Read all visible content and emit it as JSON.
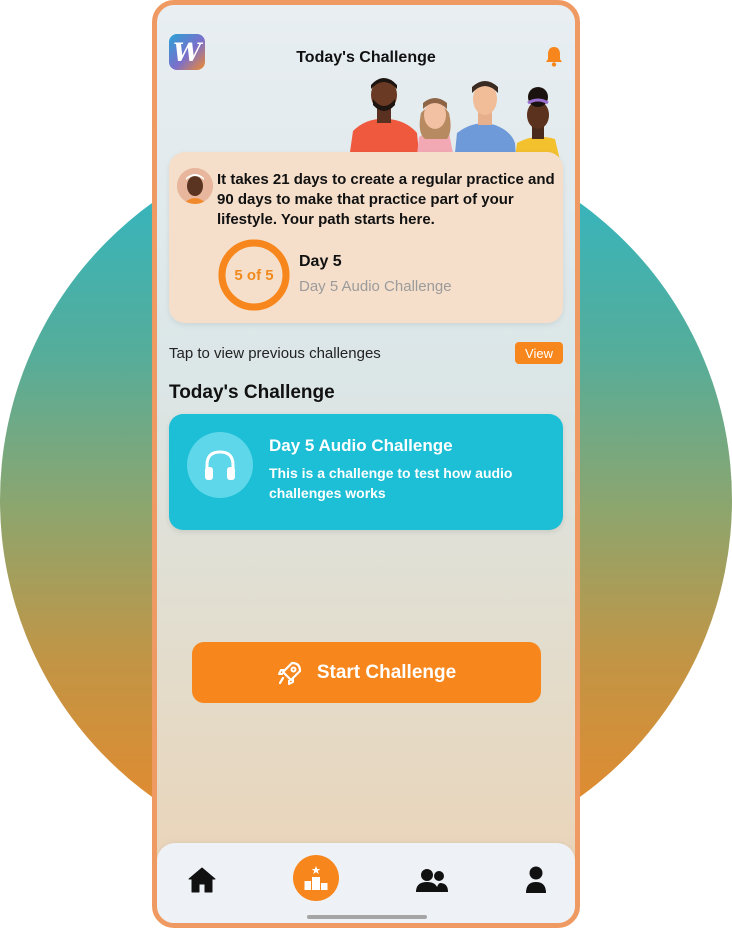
{
  "header": {
    "title": "Today's Challenge",
    "logo_letter": "W"
  },
  "info_card": {
    "message": "It takes 21 days to create a regular practice and 90 days to make that practice part of your lifestyle. Your path starts here.",
    "progress_label": "5 of 5",
    "progress_fraction": 1.0,
    "day_title": "Day 5",
    "day_subtitle": "Day 5 Audio Challenge"
  },
  "previous": {
    "text": "Tap to view previous challenges",
    "button_label": "View"
  },
  "section_title": "Today's Challenge",
  "challenge": {
    "title": "Day 5 Audio Challenge",
    "description": "This is a challenge to test how audio challenges works",
    "icon": "headphones-icon"
  },
  "start_button": {
    "label": "Start Challenge",
    "icon": "rocket-icon"
  },
  "bottom_nav": {
    "items": [
      {
        "name": "home",
        "icon": "home-icon"
      },
      {
        "name": "challenges",
        "icon": "podium-icon",
        "active": true
      },
      {
        "name": "community",
        "icon": "users-icon"
      },
      {
        "name": "profile",
        "icon": "user-icon"
      }
    ]
  },
  "colors": {
    "accent": "#f7871c",
    "teal": "#1dbfd6",
    "card": "#f5dfcb",
    "border": "#ef9a62"
  }
}
